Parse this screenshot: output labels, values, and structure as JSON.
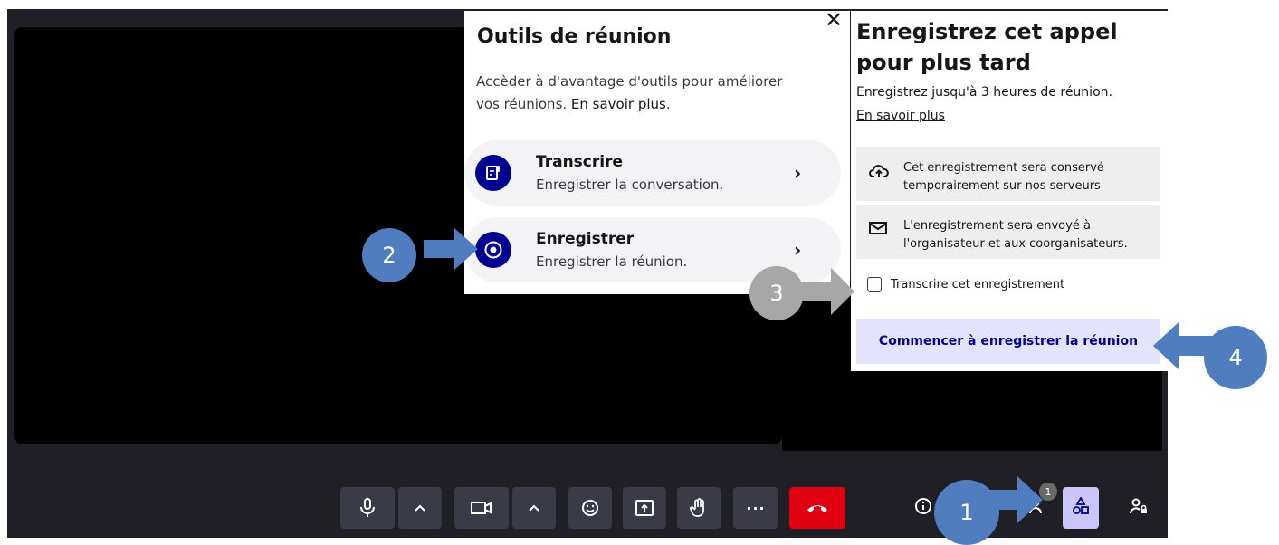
{
  "tools_panel": {
    "title": "Outils de réunion",
    "close_glyph": "✕",
    "desc_text": "Accèder à d'avantage d'outils pour améliorer vos réunions. ",
    "desc_link": "En savoir plus",
    "desc_end": ".",
    "items": [
      {
        "name": "Transcrire",
        "sub": "Enregistrer la conversation.",
        "icon": "transcribe-icon"
      },
      {
        "name": "Enregistrer",
        "sub": "Enregistrer la réunion.",
        "icon": "record-icon"
      }
    ],
    "chevron": "›"
  },
  "record_panel": {
    "title": "Enregistrez cet appel pour plus tard",
    "desc": "Enregistrez jusqu'à 3 heures de réunion.",
    "link": "En savoir plus",
    "info": [
      {
        "line1": "Cet enregistrement sera conservé",
        "line2": "temporairement sur nos serveurs",
        "icon": "cloud-upload-icon"
      },
      {
        "line1": "L'enregistrement sera envoyé à",
        "line2": "l'organisateur et aux coorganisateurs.",
        "icon": "mail-icon"
      }
    ],
    "checkbox_label": "Transcrire cet enregistrement",
    "start_button": "Commencer à enregistrer la réunion"
  },
  "toolbar": {
    "badge": "1",
    "icons": [
      "microphone-icon",
      "chevron-up-icon",
      "camera-icon",
      "chevron-up-icon",
      "emoji-icon",
      "share-screen-icon",
      "raise-hand-icon",
      "more-icon",
      "hangup-icon",
      "info-icon",
      "participants-icon",
      "tools-icon",
      "admin-icon"
    ],
    "more_label": "···"
  },
  "callouts": [
    "1",
    "2",
    "3",
    "4"
  ],
  "colors": {
    "accent": "#000091",
    "callout_blue": "#4f7dc0",
    "callout_gray": "#a7a7a7",
    "hangup": "#e1000f",
    "toolbar_bg": "#1f1f25"
  }
}
